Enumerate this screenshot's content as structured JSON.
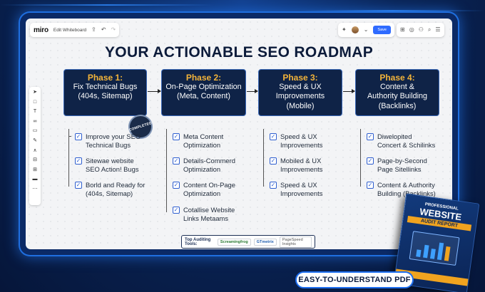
{
  "toolbar": {
    "logo": "miro",
    "board_name": "Edit Whiteboard",
    "save_label": "Save",
    "notification_count": "1"
  },
  "title": "YOUR ACTIONABLE SEO ROADMAP",
  "badge": "COMPLETED",
  "phases": [
    {
      "heading": "Phase 1:",
      "line1": "Fix Technical Bugs",
      "line2": "(404s, Sitemap)",
      "line3": ""
    },
    {
      "heading": "Phase 2:",
      "line1": "On-Page Optimization",
      "line2": "(Meta, Content)",
      "line3": ""
    },
    {
      "heading": "Phase 3:",
      "line1": "Speed & UX",
      "line2": "Improvements",
      "line3": "(Mobile)"
    },
    {
      "heading": "Phase 4:",
      "line1": "Content &",
      "line2": "Authority Building",
      "line3": "(Backlinks)"
    }
  ],
  "lists": [
    [
      {
        "l1": "Improve your SEO",
        "l2": "Technical Bugs"
      },
      {
        "l1": "Sitewae website",
        "l2": "SEO Action! Bugs"
      },
      {
        "l1": "Borld and Ready for",
        "l2": "(404s, Sitemap)"
      }
    ],
    [
      {
        "l1": "Meta Content",
        "l2": "Optimization"
      },
      {
        "l1": "Details-Commerd",
        "l2": "Optimization"
      },
      {
        "l1": "Content On-Page",
        "l2": "Optimization"
      },
      {
        "l1": "Cotallise Website",
        "l2": "Links Metaams"
      }
    ],
    [
      {
        "l1": "Speed & UX",
        "l2": "Improvements"
      },
      {
        "l1": "Mobiled & UX",
        "l2": "Improvements"
      },
      {
        "l1": "Speed & UX",
        "l2": "Improvements"
      }
    ],
    [
      {
        "l1": "Diwelopited",
        "l2": "Concert & Schilinks"
      },
      {
        "l1": "Page-by-Second",
        "l2": "Page Sitellinks"
      },
      {
        "l1": "Content & Authority",
        "l2": "Building (Backlinks)"
      }
    ]
  ],
  "tools": {
    "label": "Top Auditing Tools:",
    "items": [
      "Screamingfrog",
      "GTmetrix",
      "PageSpeed Insights"
    ]
  },
  "book": {
    "line1": "PROFESSIONAL",
    "line2a": "WEBSITE",
    "line2b": "AUDIT REPORT"
  },
  "cta": "EASY-TO-UNDERSTAND PDF",
  "icons": {
    "rail": [
      "cursor-icon",
      "frame-icon",
      "text-icon",
      "link-icon",
      "shape-icon",
      "pen-icon",
      "connector-icon",
      "table-icon",
      "grid-icon",
      "comment-icon",
      "more-icon"
    ]
  },
  "colors": {
    "phase_bg": "#0f2347",
    "phase_heading": "#f3b43a",
    "accent": "#2f6bff"
  }
}
